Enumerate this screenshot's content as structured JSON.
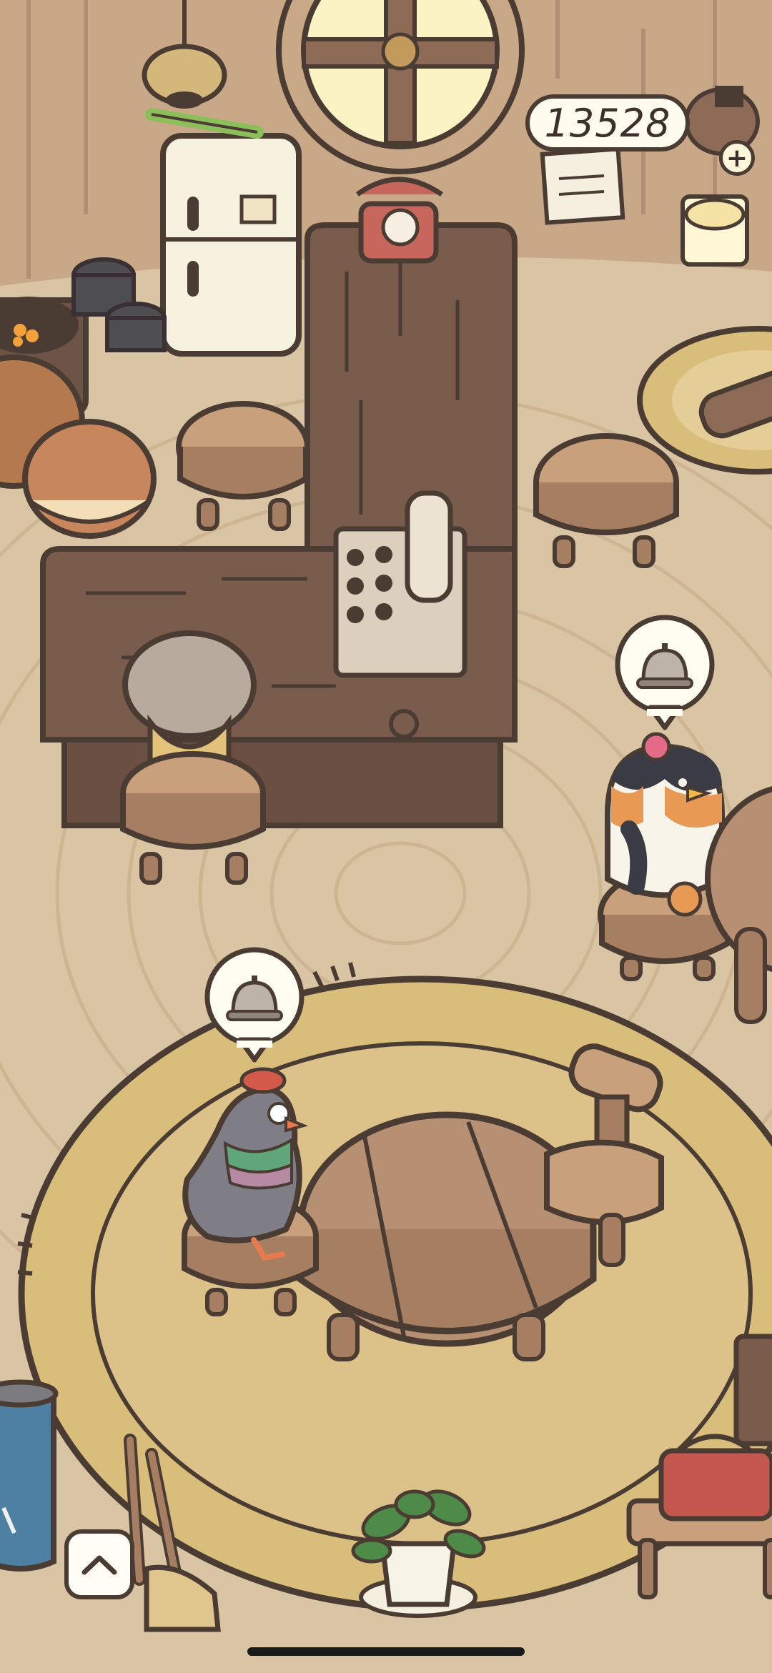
{
  "hud": {
    "coin_balance": "13528",
    "add_coins_symbol": "+",
    "scroll_up_icon": "chevron-up-icon"
  },
  "scene": {
    "colors": {
      "floor": "#d9c4a3",
      "outline": "#4a3b33",
      "counter_wood": "#7a5c4d",
      "rug": "#d8bd7b",
      "table_wood": "#b78f73"
    },
    "customers": [
      {
        "name": "customer-penguin",
        "request_icon": "service-bell-icon"
      },
      {
        "name": "customer-pigeon",
        "request_icon": "service-bell-icon"
      },
      {
        "name": "customer-bird-at-counter",
        "request_icon": ""
      }
    ]
  }
}
